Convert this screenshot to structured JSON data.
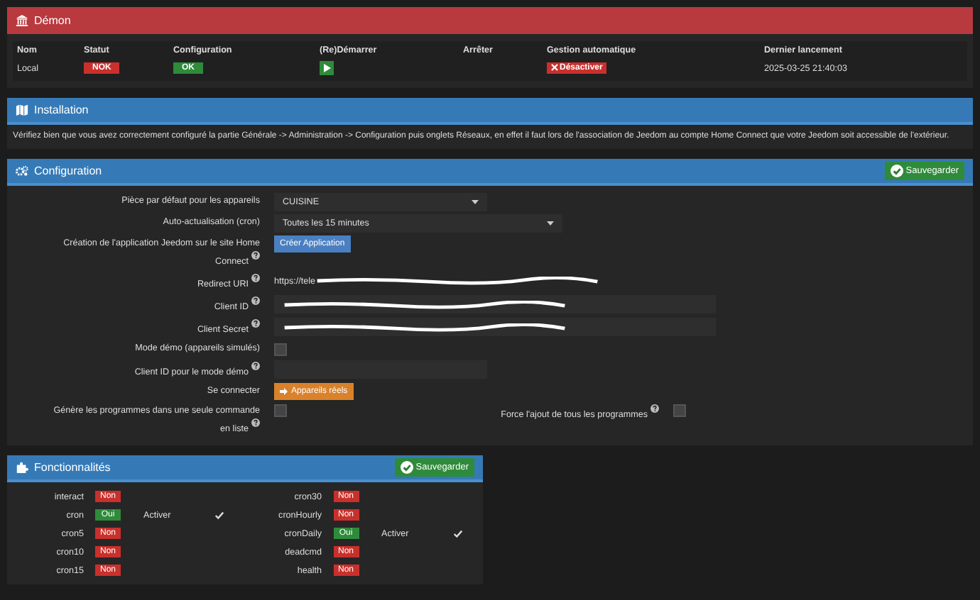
{
  "demon": {
    "title": "Démon",
    "columns": [
      "Nom",
      "Statut",
      "Configuration",
      "(Re)Démarrer",
      "Arrêter",
      "Gestion automatique",
      "Dernier lancement"
    ],
    "row": [
      {
        "kind": "text",
        "text": "Local"
      },
      {
        "kind": "badge",
        "text": "NOK",
        "color": "#c9302c"
      },
      {
        "kind": "badge",
        "text": "OK",
        "color": "#2e8b3a"
      },
      {
        "kind": "play"
      },
      {
        "kind": "empty"
      },
      {
        "kind": "button",
        "text": "Désactiver"
      },
      {
        "kind": "text",
        "text": "2025-03-25 21:40:03"
      }
    ]
  },
  "installation": {
    "title": "Installation",
    "text": "Vérifiez bien que vous avez correctement configuré la partie Générale -> Administration -> Configuration puis onglets Réseaux, en effet il faut lors de l'association de Jeedom au compte Home Connect que votre Jeedom soit accessible de l'extérieur."
  },
  "configuration": {
    "title": "Configuration",
    "save": "Sauvegarder",
    "rows": [
      {
        "kind": "select",
        "label": "Pièce par défaut pour les appareils",
        "help": false,
        "value": "CUISINE",
        "wide": false
      },
      {
        "kind": "select",
        "label": "Auto-actualisation (cron)",
        "help": false,
        "value": "Toutes les 15 minutes",
        "wide": true
      },
      {
        "kind": "create-button",
        "label": "Création de l'application Jeedom sur le site Home Connect",
        "help": true,
        "button": "Créer Application"
      },
      {
        "kind": "redacted-text",
        "label": "Redirect URI",
        "help": true,
        "value": "https://tele"
      },
      {
        "kind": "redacted-input",
        "label": "Client ID",
        "help": true
      },
      {
        "kind": "redacted-input",
        "label": "Client Secret",
        "help": true
      },
      {
        "kind": "checkbox",
        "label": "Mode démo (appareils simulés)",
        "help": false,
        "checked": false
      },
      {
        "kind": "input",
        "label": "Client ID pour le mode démo",
        "help": true
      },
      {
        "kind": "connect-button",
        "label": "Se connecter",
        "help": false,
        "button": "Appareils réels"
      },
      {
        "kind": "checkbox-pair",
        "label": "Génère les programmes dans une seule commande en liste",
        "help": true,
        "checked": false,
        "label2": "Force l'ajout de tous les programmes",
        "help2": true,
        "checked2": false
      }
    ]
  },
  "fonctionnalites": {
    "title": "Fonctionnalités",
    "save": "Sauvegarder",
    "columns": [
      [
        {
          "name": "interact",
          "on": false,
          "status": "Non"
        },
        {
          "name": "cron",
          "on": true,
          "status": "Oui",
          "toggle": "Activer",
          "checked": true
        },
        {
          "name": "cron5",
          "on": false,
          "status": "Non"
        },
        {
          "name": "cron10",
          "on": false,
          "status": "Non"
        },
        {
          "name": "cron15",
          "on": false,
          "status": "Non"
        }
      ],
      [
        {
          "name": "cron30",
          "on": false,
          "status": "Non"
        },
        {
          "name": "cronHourly",
          "on": false,
          "status": "Non"
        },
        {
          "name": "cronDaily",
          "on": true,
          "status": "Oui",
          "toggle": "Activer",
          "checked": true
        },
        {
          "name": "deadcmd",
          "on": false,
          "status": "Non"
        },
        {
          "name": "health",
          "on": false,
          "status": "Non"
        }
      ]
    ]
  }
}
